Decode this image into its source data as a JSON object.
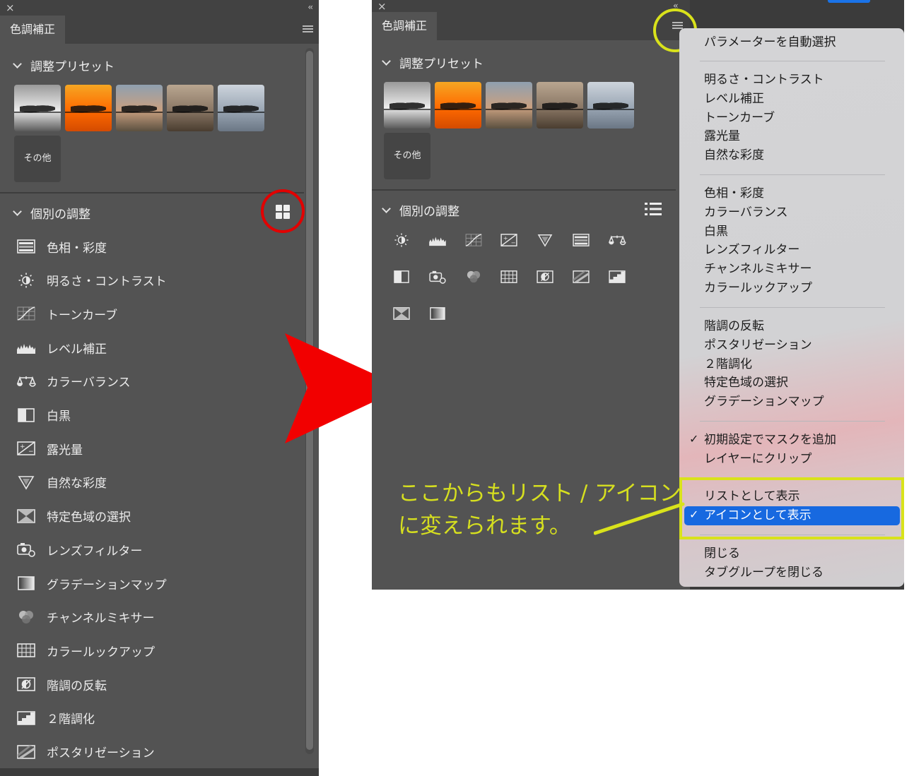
{
  "left_panel": {
    "close_symbol": "×",
    "collapse_symbol": "‹‹",
    "tab_label": "色調補正",
    "presets_heading": "調整プリセット",
    "presets": [
      {
        "name": "preset-grayscale",
        "colors": [
          "#9a9a9a",
          "#ececec",
          "#5a5a5a"
        ]
      },
      {
        "name": "preset-sunset",
        "colors": [
          "#f5a623",
          "#ff6a00",
          "#d44b00"
        ]
      },
      {
        "name": "preset-muted",
        "colors": [
          "#8fa0b0",
          "#c9a080",
          "#5b5040"
        ]
      },
      {
        "name": "preset-sepia",
        "colors": [
          "#b9a690",
          "#8a7765",
          "#4a3d30"
        ]
      },
      {
        "name": "preset-cool",
        "colors": [
          "#cdd4dc",
          "#9aa6b4",
          "#6b7785"
        ]
      }
    ],
    "more_label": "その他",
    "individual_heading": "個別の調整",
    "items": [
      {
        "label": "色相・彩度",
        "icon": "hue-saturation-icon"
      },
      {
        "label": "明るさ・コントラスト",
        "icon": "brightness-contrast-icon"
      },
      {
        "label": "トーンカーブ",
        "icon": "curves-icon"
      },
      {
        "label": "レベル補正",
        "icon": "levels-icon"
      },
      {
        "label": "カラーバランス",
        "icon": "color-balance-icon"
      },
      {
        "label": "白黒",
        "icon": "black-white-icon"
      },
      {
        "label": "露光量",
        "icon": "exposure-icon"
      },
      {
        "label": "自然な彩度",
        "icon": "vibrance-icon"
      },
      {
        "label": "特定色域の選択",
        "icon": "selective-color-icon"
      },
      {
        "label": "レンズフィルター",
        "icon": "photo-filter-icon"
      },
      {
        "label": "グラデーションマップ",
        "icon": "gradient-map-icon"
      },
      {
        "label": "チャンネルミキサー",
        "icon": "channel-mixer-icon"
      },
      {
        "label": "カラールックアップ",
        "icon": "color-lookup-icon"
      },
      {
        "label": "階調の反転",
        "icon": "invert-icon"
      },
      {
        "label": "２階調化",
        "icon": "threshold-icon"
      },
      {
        "label": "ポスタリゼーション",
        "icon": "posterize-icon"
      }
    ]
  },
  "right_panel": {
    "close_symbol": "×",
    "collapse_symbol": "‹‹",
    "tab_label": "色調補正",
    "presets_heading": "調整プリセット",
    "more_label": "その他",
    "individual_heading": "個別の調整",
    "icon_grid": [
      "brightness-contrast-icon",
      "levels-icon",
      "curves-icon",
      "exposure-icon",
      "vibrance-icon",
      "hue-saturation-icon",
      "color-balance-icon",
      "black-white-icon",
      "photo-filter-icon",
      "channel-mixer-icon",
      "color-lookup-icon",
      "invert-icon",
      "posterize-icon",
      "threshold-icon",
      "selective-color-icon",
      "gradient-map-icon"
    ]
  },
  "menu": {
    "groups": [
      [
        "パラメーターを自動選択"
      ],
      [
        "明るさ・コントラスト",
        "レベル補正",
        "トーンカーブ",
        "露光量",
        "自然な彩度"
      ],
      [
        "色相・彩度",
        "カラーバランス",
        "白黒",
        "レンズフィルター",
        "チャンネルミキサー",
        "カラールックアップ"
      ],
      [
        "階調の反転",
        "ポスタリゼーション",
        "２階調化",
        "特定色域の選択",
        "グラデーションマップ"
      ],
      [
        "初期設定でマスクを追加",
        "レイヤーにクリップ"
      ],
      [
        "リストとして表示",
        "アイコンとして表示"
      ],
      [
        "閉じる",
        "タブグループを閉じる"
      ]
    ],
    "checked": [
      "初期設定でマスクを追加",
      "アイコンとして表示"
    ],
    "selected": "アイコンとして表示",
    "check_symbol": "✓"
  },
  "annotation": {
    "line1": "ここからもリスト / アイコン",
    "line2": "に変えられます。"
  },
  "colors": {
    "panel_bg": "#535353",
    "highlight_red": "#e20000",
    "highlight_yellow": "#d9e21b",
    "selection_blue": "#1769e0"
  }
}
